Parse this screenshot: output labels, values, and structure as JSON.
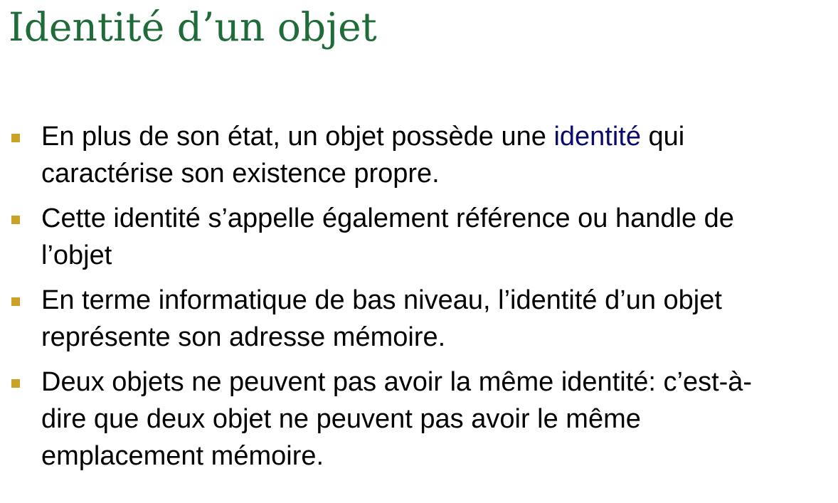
{
  "slide": {
    "title": "Identité d’un objet",
    "colors": {
      "title": "#1f6b3a",
      "bullet_marker": "#c9a227",
      "highlight": "#0b0b6e",
      "text": "#000000"
    },
    "bullets": [
      {
        "text_before": "En plus de son état, un objet possède une ",
        "highlight": "identité",
        "text_after": " qui caractérise son existence propre."
      },
      {
        "text": "Cette identité s’appelle également référence ou handle de l’objet"
      },
      {
        "text": "En terme informatique de bas niveau, l’identité d’un objet représente son adresse mémoire."
      },
      {
        "text": "Deux objets ne peuvent pas avoir la même identité: c’est-à-dire que deux objet ne peuvent pas avoir le même emplacement mémoire."
      }
    ]
  }
}
